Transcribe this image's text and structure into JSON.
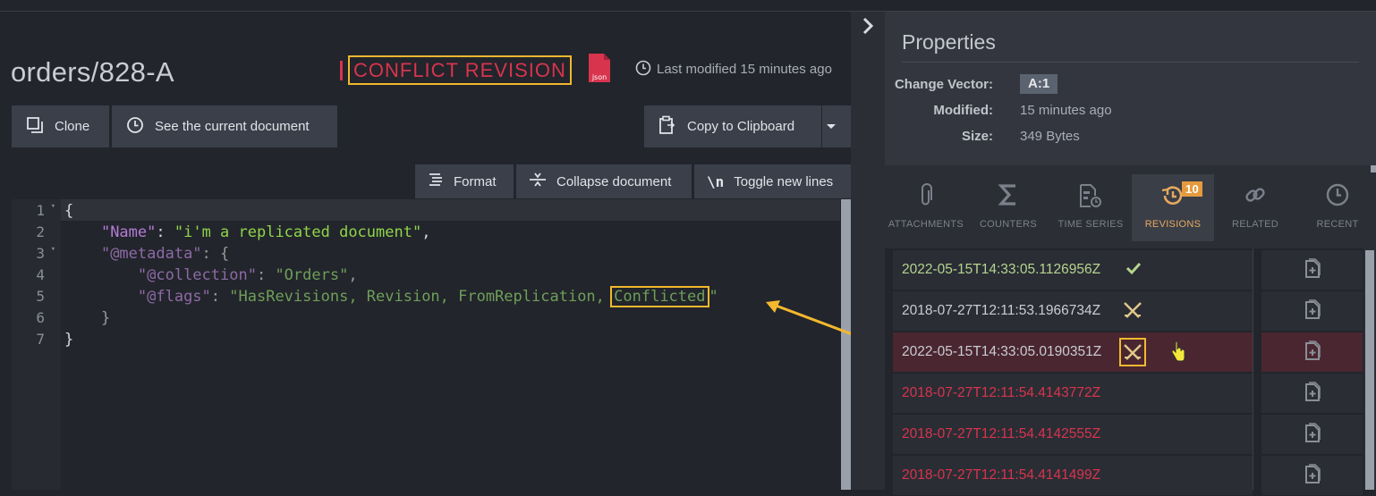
{
  "document": {
    "title": "orders/828-A",
    "status_label": "CONFLICT REVISION",
    "json_icon_text": "json",
    "last_modified": "Last modified 15 minutes ago"
  },
  "toolbar": {
    "clone": "Clone",
    "see_current": "See the current document",
    "copy_clipboard": "Copy to Clipboard"
  },
  "editor_toolbar": {
    "format": "Format",
    "collapse": "Collapse document",
    "toggle_new_lines": "Toggle new lines"
  },
  "editor": {
    "line_numbers": [
      "1",
      "2",
      "3",
      "4",
      "5",
      "6",
      "7"
    ],
    "lines": [
      "{",
      "\"Name\": \"i'm a replicated document\",",
      "\"@metadata\": {",
      "\"@collection\": \"Orders\",",
      "\"@flags\": \"HasRevisions, Revision, FromReplication, Conflicted\"",
      "}",
      "}"
    ],
    "tokens": {
      "name_key": "\"Name\"",
      "name_value": "\"i'm a replicated document\"",
      "metadata_key": "\"@metadata\"",
      "collection_key": "\"@collection\"",
      "collection_value": "\"Orders\"",
      "flags_key": "\"@flags\"",
      "flags_value_prefix": "\"HasRevisions, Revision, FromReplication, ",
      "flags_value_highlight": "Conflicted",
      "flags_value_suffix": "\""
    }
  },
  "properties": {
    "title": "Properties",
    "change_vector_label": "Change Vector:",
    "change_vector_value": "A:1",
    "modified_label": "Modified:",
    "modified_value": "15 minutes ago",
    "size_label": "Size:",
    "size_value": "349 Bytes"
  },
  "tabs": [
    {
      "label": "ATTACHMENTS",
      "icon": "paperclip-icon"
    },
    {
      "label": "COUNTERS",
      "icon": "sigma-icon"
    },
    {
      "label": "TIME SERIES",
      "icon": "timeseries-icon"
    },
    {
      "label": "REVISIONS",
      "icon": "revisions-icon",
      "badge": "10",
      "active": true
    },
    {
      "label": "RELATED",
      "icon": "link-icon"
    },
    {
      "label": "RECENT",
      "icon": "clock-icon"
    }
  ],
  "revisions": [
    {
      "timestamp": "2022-05-15T14:33:05.1126956Z",
      "status": "current"
    },
    {
      "timestamp": "2018-07-27T12:11:53.1966734Z",
      "status": "conflicted"
    },
    {
      "timestamp": "2022-05-15T14:33:05.0190351Z",
      "status": "conflicted",
      "selected": true
    },
    {
      "timestamp": "2018-07-27T12:11:54.4143772Z",
      "status": "deleted"
    },
    {
      "timestamp": "2018-07-27T12:11:54.4142555Z",
      "status": "deleted"
    },
    {
      "timestamp": "2018-07-27T12:11:54.4141499Z",
      "status": "deleted"
    }
  ],
  "colors": {
    "accent_conflict": "#d8344e",
    "highlight_box": "#f3b82f",
    "badge_orange": "#e59b3d",
    "json_icon": "#d8344e"
  }
}
